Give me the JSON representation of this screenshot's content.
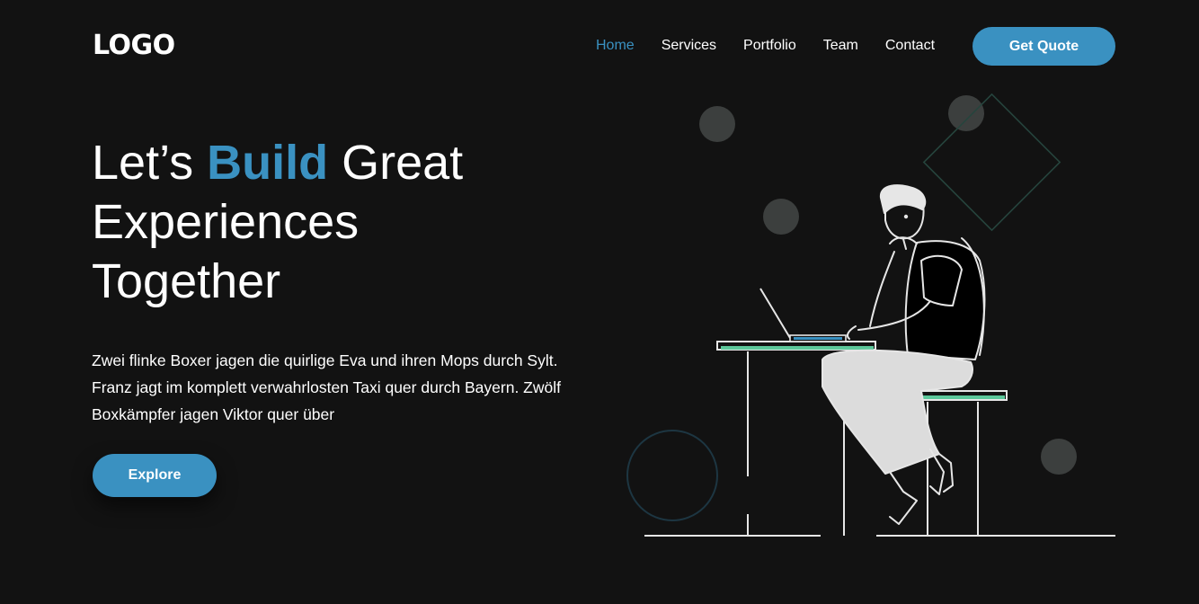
{
  "header": {
    "logo": "LOGO",
    "nav": [
      {
        "label": "Home",
        "active": true
      },
      {
        "label": "Services",
        "active": false
      },
      {
        "label": "Portfolio",
        "active": false
      },
      {
        "label": "Team",
        "active": false
      },
      {
        "label": "Contact",
        "active": false
      }
    ],
    "cta_label": "Get Quote"
  },
  "hero": {
    "title_part1": "Let’s ",
    "title_accent": "Build",
    "title_part2": " Great",
    "title_line2": "Experiences",
    "title_line3": "Together",
    "description": "Zwei flinke Boxer jagen die quirlige Eva und ihren Mops durch Sylt. Franz jagt im komplett verwahrlosten Taxi quer durch Bayern. Zwölf Boxkämpfer jagen Viktor quer über",
    "button_label": "Explore"
  },
  "illustration": {
    "subject": "person-working-on-laptop",
    "colors": {
      "accent": "#3a91c1",
      "desk_stripe": "#5cc79a",
      "line": "#e6e6e6",
      "circle_fill": "#3c3f3e",
      "outline_shape": "#2a4a44"
    }
  }
}
